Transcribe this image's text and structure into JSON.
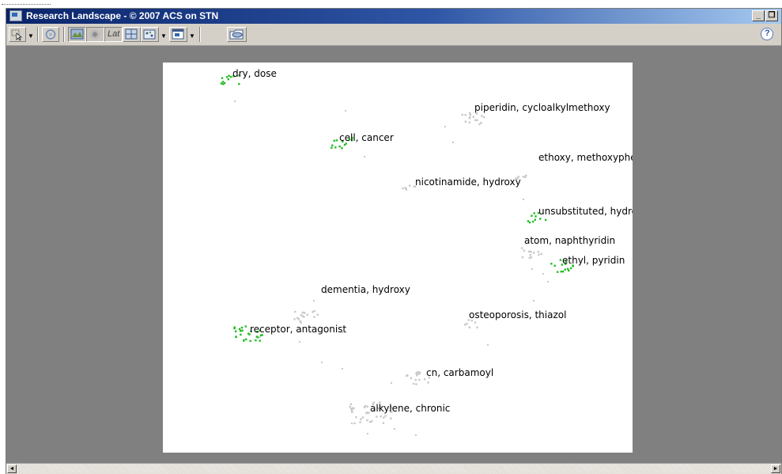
{
  "window": {
    "title": "Research Landscape - © 2007 ACS on STN",
    "minimize_glyph": "_",
    "restore_glyph": "❐"
  },
  "toolbar": {
    "help_glyph": "?",
    "layers_text": "Lat"
  },
  "clusters": [
    {
      "label": "dry, dose",
      "color": "#22bb22"
    },
    {
      "label": "piperidin, cycloalkylmethoxy",
      "color": "#c8c8c8"
    },
    {
      "label": "cell, cancer",
      "color": "#22bb22"
    },
    {
      "label": "ethoxy, methoxyphenyl",
      "color": "#c8c8c8"
    },
    {
      "label": "nicotinamide, hydroxy",
      "color": "#c8c8c8"
    },
    {
      "label": "unsubstituted, hydrogen",
      "color": "#22bb22"
    },
    {
      "label": "atom, naphthyridin",
      "color": "#c8c8c8"
    },
    {
      "label": "ethyl, pyridin",
      "color": "#22bb22"
    },
    {
      "label": "dementia, hydroxy",
      "color": "#c8c8c8"
    },
    {
      "label": "osteoporosis, thiazol",
      "color": "#c8c8c8"
    },
    {
      "label": "receptor, antagonist",
      "color": "#22bb22"
    },
    {
      "label": "cn, carbamoyl",
      "color": "#c8c8c8"
    },
    {
      "label": "alkylene, chronic",
      "color": "#c8c8c8"
    }
  ],
  "colors": {
    "document_dot": "#c8c8c8",
    "highlight_dot": "#22bb22",
    "title_gradient_start": "#0a246a",
    "title_gradient_end": "#a6caf0"
  }
}
